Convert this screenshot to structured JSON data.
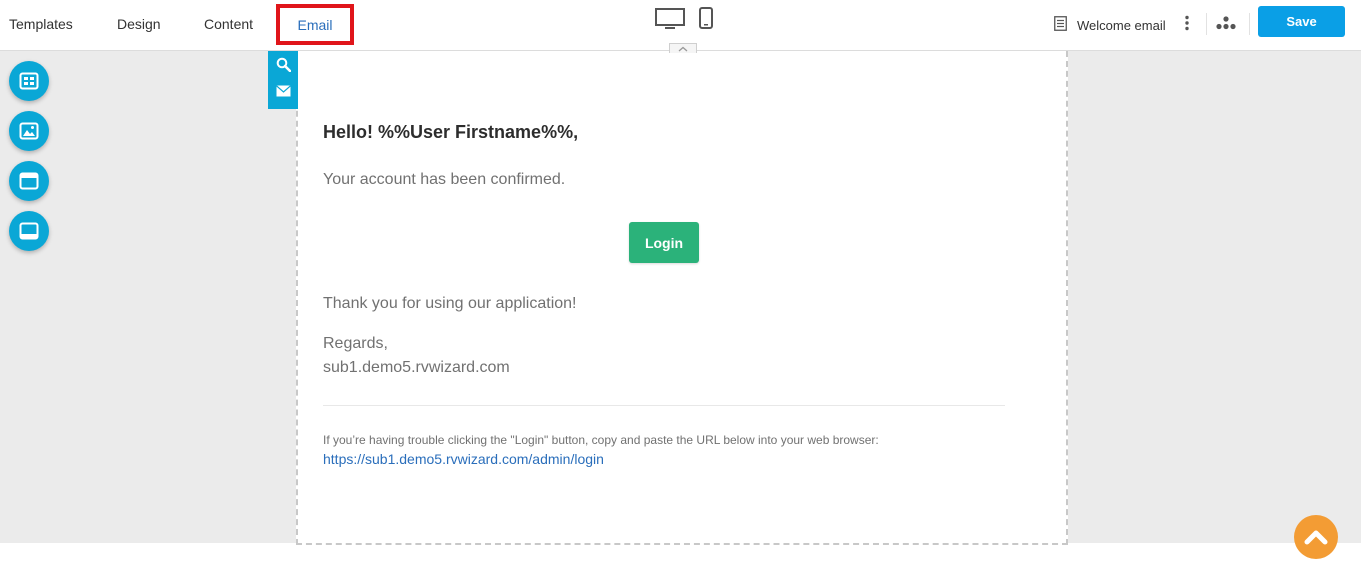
{
  "nav": {
    "tabs": [
      {
        "label": "Templates"
      },
      {
        "label": "Design"
      },
      {
        "label": "Content"
      },
      {
        "label": "Email",
        "active": true
      }
    ]
  },
  "devices": [
    "desktop-icon",
    "mobile-icon"
  ],
  "document": {
    "title": "Welcome email"
  },
  "toolbar": {
    "save_label": "Save"
  },
  "side_panel": {
    "icons": [
      "blocks-icon",
      "image-icon",
      "header-icon",
      "footer-icon"
    ]
  },
  "email_tools": [
    "search-icon",
    "envelope-icon"
  ],
  "email": {
    "greeting": "Hello! %%User Firstname%%,",
    "body": "Your account has been confirmed.",
    "button_label": "Login",
    "thanks": "Thank you for using our application!",
    "regards": "Regards,",
    "domain": "sub1.demo5.rvwizard.com",
    "trouble_text": "If you’re having trouble clicking the \"Login\" button, copy and paste the URL below into your web browser:",
    "url": "https://sub1.demo5.rvwizard.com/admin/login"
  },
  "colors": {
    "accent": "#0aa7d6",
    "save": "#0a9fe6",
    "login": "#2bb27a",
    "highlight": "#e0151a",
    "scroll_top": "#f39c34",
    "link": "#2a6ebb"
  }
}
